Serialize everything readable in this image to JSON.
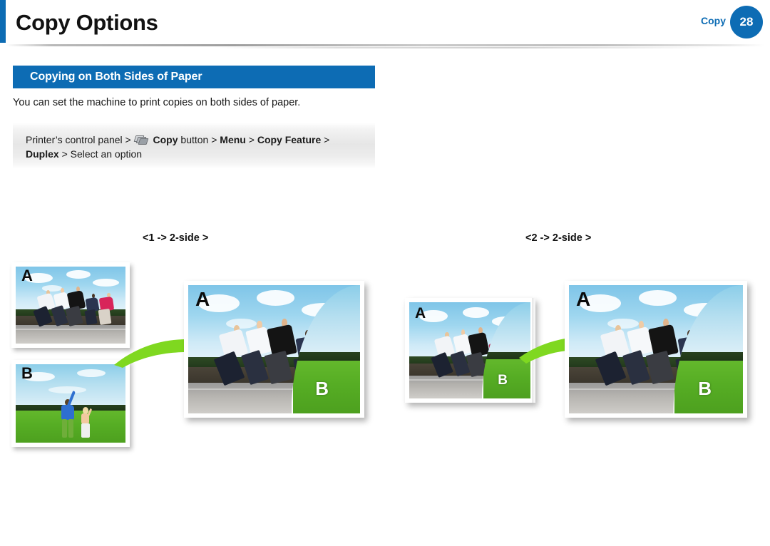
{
  "header": {
    "title": "Copy Options",
    "chapter_label": "Copy",
    "page_number": "28",
    "accent_color": "#0d6cb4"
  },
  "section": {
    "heading": "Copying on Both Sides of Paper",
    "intro": "You can set the machine to print copies on both sides of paper."
  },
  "path_box": {
    "icon": "copy-button-icon",
    "segment_1": "Printer’s control panel >",
    "segment_2_bold": "Copy",
    "segment_3": " button > ",
    "segment_4_bold": "Menu",
    "segment_5": " > ",
    "segment_6_bold": "Copy Feature",
    "segment_7": " >",
    "segment_8_bold": "Duplex",
    "segment_9": " > Select an option"
  },
  "illustration": {
    "left_mode_label": "<1 -> 2-side >",
    "right_mode_label": "<2 -> 2-side >",
    "arrow_color": "#7fd820",
    "originals": [
      {
        "label": "A",
        "scene": "people-leaning-on-pier"
      },
      {
        "label": "B",
        "scene": "man-and-child-in-green-field"
      }
    ],
    "result_front_label": "A",
    "result_back_label": "B",
    "source_duplex_front_label": "A",
    "source_duplex_back_label": "B"
  }
}
